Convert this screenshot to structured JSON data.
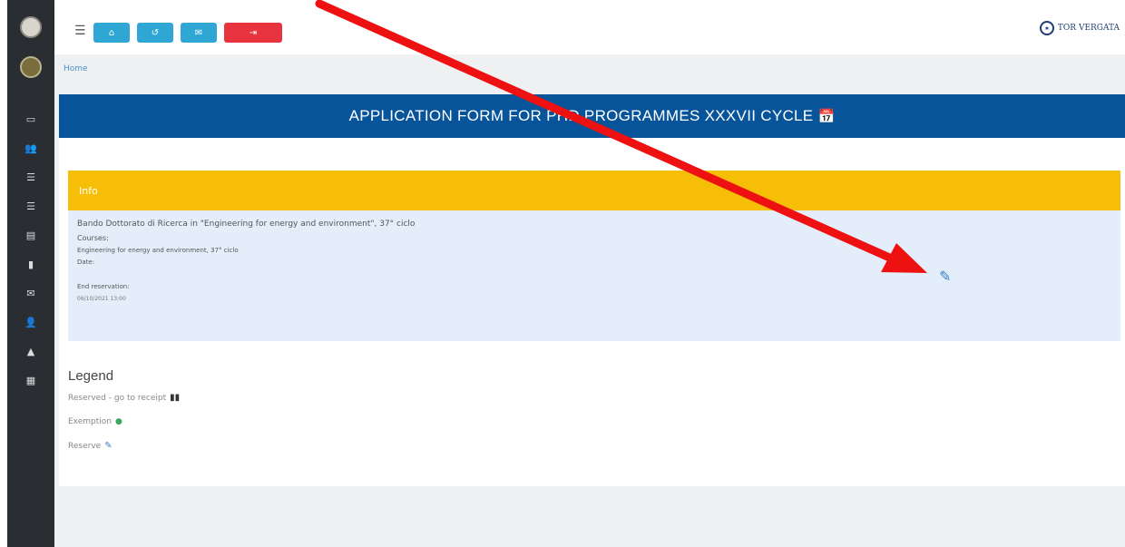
{
  "toolbar": {
    "menu_icon": "☰",
    "buttons": [
      {
        "name": "home",
        "glyph": "⌂",
        "color": "#2fa7d4"
      },
      {
        "name": "back",
        "glyph": "↺",
        "color": "#2fa7d4"
      },
      {
        "name": "mail",
        "glyph": "✉",
        "color": "#2fa7d4"
      },
      {
        "name": "logout",
        "glyph": "⇥",
        "color": "#e8343f"
      }
    ],
    "logo_text": "TOR VERGATA"
  },
  "breadcrumb": "Home",
  "page": {
    "title": "APPLICATION FORM FOR PHD PROGRAMMES XXXVII CYCLE",
    "title_icon": "📅"
  },
  "info": {
    "header": "Info",
    "call": "Bando Dottorato di Ricerca in \"Engineering for energy and environment\", 37° ciclo",
    "courses_label": "Courses:",
    "course": "Engineering for energy and environment, 37° ciclo",
    "date_label": "Date:",
    "end_reservation_label": "End reservation:",
    "end_reservation_value": "06/10/2021 13:00"
  },
  "legend": {
    "title": "Legend",
    "reserved": "Reserved - go to receipt",
    "exemption": "Exemption",
    "reserve": "Reserve"
  },
  "colors": {
    "sidebar": "#2a2d31",
    "title_bar": "#08549b",
    "info_header": "#f7be08",
    "info_body": "#e3eefa",
    "arrow": "#ee1111",
    "edit_icon": "#3a80c9"
  }
}
